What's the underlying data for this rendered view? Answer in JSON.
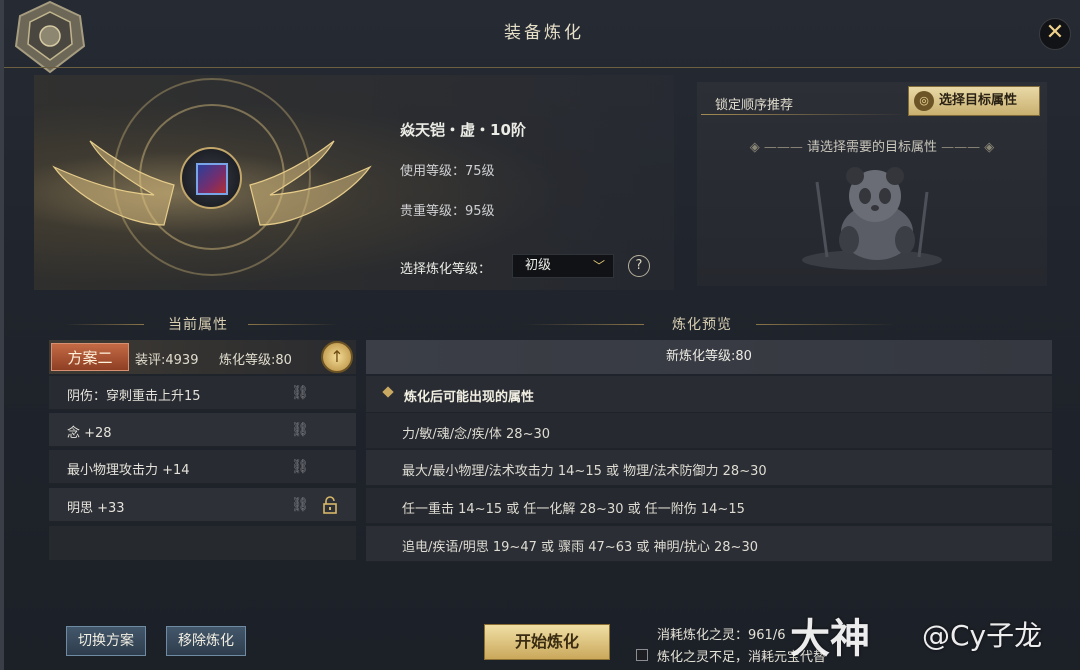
{
  "window": {
    "title": "装备炼化",
    "close_icon": "close-icon"
  },
  "item": {
    "name": "焱天铠・虚・10阶",
    "use_level": "使用等级：75级",
    "value_level": "贵重等级：95级",
    "refine_level_label": "选择炼化等级：",
    "refine_level_value": "初级",
    "help": "?"
  },
  "target_panel": {
    "lock_order_label": "锁定顺序推荐",
    "select_target_button": "选择目标属性",
    "hint": "请选择需要的目标属性"
  },
  "current": {
    "header": "当前属性",
    "scheme_tag": "方案二",
    "score": "装评:4939",
    "refine_level": "炼化等级:80",
    "upgrade_icon": "↑",
    "attributes": [
      {
        "text": "阴伤：穿刺重击上升15",
        "locked": false
      },
      {
        "text": "念 +28",
        "locked": false
      },
      {
        "text": "最小物理攻击力 +14",
        "locked": false
      },
      {
        "text": "明思 +33",
        "locked": true
      }
    ]
  },
  "preview": {
    "header": "炼化预览",
    "new_level": "新炼化等级:80",
    "possible_header": "炼化后可能出现的属性",
    "rows": [
      "力/敏/魂/念/疾/体 28~30",
      "最大/最小物理/法术攻击力 14~15 或 物理/法术防御力 28~30",
      "任一重击 14~15 或 任一化解 28~30 或 任一附伤 14~15",
      "追电/疾语/明思 19~47 或 骤雨 47~63 或 神明/扰心 28~30"
    ]
  },
  "footer": {
    "switch_scheme": "切换方案",
    "remove_refine": "移除炼化",
    "start_refine": "开始炼化",
    "cost": "消耗炼化之灵：961/6",
    "insufficient": "炼化之灵不足，消耗元宝代替"
  },
  "watermark": {
    "logo": "大神",
    "user": "@Cy子龙"
  },
  "colors": {
    "accent_gold": "#c9a862",
    "scheme_tag": "#c46a45",
    "button_blue": "#43576b"
  }
}
